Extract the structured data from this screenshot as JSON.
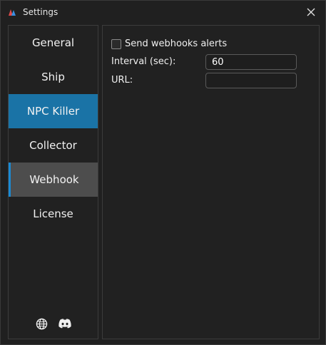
{
  "window": {
    "title": "Settings"
  },
  "sidebar": {
    "items": [
      {
        "label": "General"
      },
      {
        "label": "Ship"
      },
      {
        "label": "NPC Killer"
      },
      {
        "label": "Collector"
      },
      {
        "label": "Webhook"
      },
      {
        "label": "License"
      }
    ],
    "footer_icons": [
      "globe-icon",
      "discord-icon"
    ]
  },
  "webhook": {
    "send_alerts_label": "Send webhooks alerts",
    "send_alerts_checked": false,
    "interval_label": "Interval (sec):",
    "interval_value": "60",
    "url_label": "URL:",
    "url_value": ""
  },
  "colors": {
    "accent_blue": "#1a73a6",
    "selected_bg": "#4d4d4d",
    "selected_bar": "#1a8ad4"
  }
}
